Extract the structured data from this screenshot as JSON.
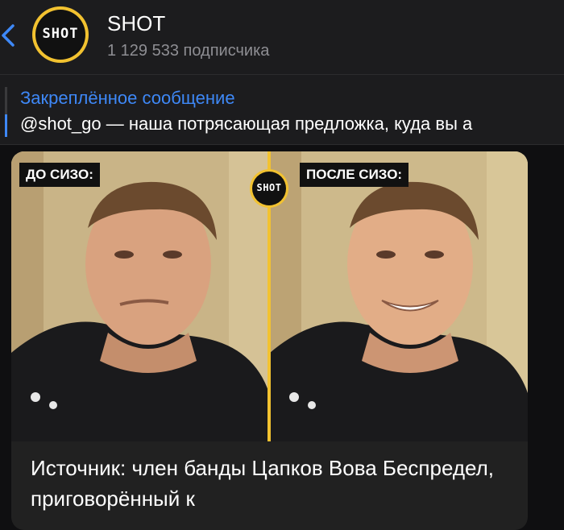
{
  "header": {
    "back_icon": "chevron-left-icon",
    "avatar_text": "SHOT",
    "title": "SHOT",
    "subscribers": "1 129 533 подписчика"
  },
  "pinned": {
    "title": "Закреплённое сообщение",
    "text": "@shot_go — наша потрясающая предложка, куда вы а"
  },
  "post": {
    "photo": {
      "left_label": "ДО СИЗО:",
      "right_label": "ПОСЛЕ СИЗО:",
      "logo_text": "SHOT"
    },
    "caption": "Источник: член банды Цапков Вова Беспредел, приговорённый к"
  },
  "colors": {
    "accent_blue": "#3e88f7",
    "brand_yellow": "#f2c230",
    "bubble": "#212121",
    "header_bg": "#1c1c1e",
    "muted_text": "#8e8e93"
  }
}
